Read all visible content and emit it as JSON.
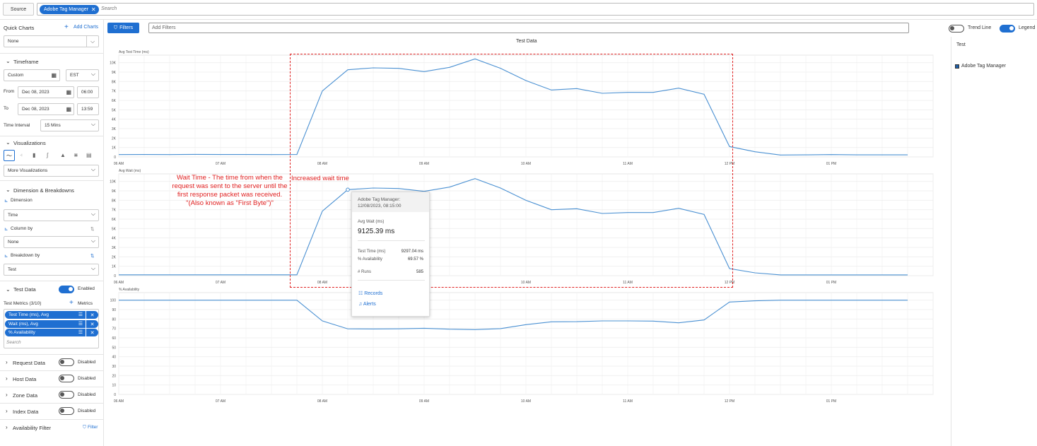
{
  "topbar": {
    "source_label": "Source",
    "chip_label": "Adobe Tag Manager",
    "search_placeholder": "Search"
  },
  "sidebar": {
    "quick_charts": {
      "title": "Quick Charts",
      "add_label": "Add Charts",
      "value": "None"
    },
    "timeframe": {
      "title": "Timeframe",
      "range_value": "Custom",
      "tz_value": "EST",
      "from_label": "From",
      "from_date": "Dec 08, 2023",
      "from_time": "06:00",
      "to_label": "To",
      "to_date": "Dec 08, 2023",
      "to_time": "13:59",
      "interval_label": "Time Interval",
      "interval_value": "15 Mins"
    },
    "visualizations": {
      "title": "Visualizations",
      "more": "More Visualizations"
    },
    "dimension": {
      "title": "Dimension & Breakdowns",
      "dimension_label": "Dimension",
      "dimension_value": "Time",
      "column_label": "Column by",
      "column_value": "None",
      "breakdown_label": "Breakdown by",
      "breakdown_value": "Test"
    },
    "test_data": {
      "title": "Test Data",
      "status": "Enabled",
      "metrics_label": "Test Metrics (3/10)",
      "metrics_add": "Metrics",
      "metrics": [
        "Test Time (ms), Avg",
        "Wait (ms), Avg",
        "% Availability"
      ],
      "search_placeholder": "Search"
    },
    "sections": [
      {
        "title": "Request Data",
        "status": "Disabled"
      },
      {
        "title": "Host Data",
        "status": "Disabled"
      },
      {
        "title": "Zone Data",
        "status": "Disabled"
      },
      {
        "title": "Index Data",
        "status": "Disabled"
      }
    ],
    "availability": {
      "title": "Availability Filter",
      "filter_label": "Filter"
    }
  },
  "filters": {
    "button": "Filters",
    "placeholder": "Add Filters"
  },
  "toggles": {
    "trend_line": "Trend Line",
    "legend": "Legend"
  },
  "main": {
    "title": "Test Data"
  },
  "legend_panel": {
    "title": "Test",
    "item": "Adobe Tag Manager",
    "item_color": "#1f5fa8"
  },
  "tooltip": {
    "head_line1": "Adobe Tag Manager:",
    "head_line2": "12/08/2023, 08:15:00",
    "metric_label": "Avg Wait (ms)",
    "metric_value": "9125.39 ms",
    "rows": [
      {
        "label": "Test Time (ms)",
        "value": "9297.04 ms"
      },
      {
        "label": "% Availability",
        "value": "69.57 %"
      },
      {
        "label": "# Runs",
        "value": "585"
      }
    ],
    "records": "Records",
    "alerts": "Alerts"
  },
  "annotations": {
    "wait_time": [
      "Wait Time - The time from when the",
      "request was sent to the server until the",
      "first response packet was received.",
      "\"(Also known as \"First Byte\")\""
    ],
    "increased": "Increased wait time",
    "color": "#e02020"
  },
  "chart_data": [
    {
      "type": "line",
      "title": "",
      "ylabel": "Avg Test Time (ms)",
      "xlabel": "",
      "x_ticks": [
        "06 AM",
        "07 AM",
        "08 AM",
        "09 AM",
        "10 AM",
        "11 AM",
        "12 PM",
        "01 PM"
      ],
      "y_ticks": [
        "0",
        "1K",
        "2K",
        "3K",
        "4K",
        "5K",
        "6K",
        "7K",
        "8K",
        "9K",
        "10K"
      ],
      "ylim": [
        0,
        10500
      ],
      "x": [
        6,
        6.25,
        6.5,
        6.75,
        7,
        7.25,
        7.5,
        7.75,
        8,
        8.25,
        8.5,
        8.75,
        9,
        9.25,
        9.5,
        9.75,
        10,
        10.25,
        10.5,
        10.75,
        11,
        11.25,
        11.5,
        11.75,
        12,
        12.25,
        12.5,
        12.75,
        13,
        13.25,
        13.5,
        13.75
      ],
      "values": [
        250,
        260,
        250,
        270,
        255,
        260,
        250,
        260,
        7000,
        9250,
        9450,
        9400,
        9050,
        9500,
        10400,
        9400,
        8100,
        7100,
        7250,
        6750,
        6850,
        6850,
        7300,
        6650,
        1100,
        550,
        200,
        220,
        250,
        220,
        220,
        220
      ]
    },
    {
      "type": "line",
      "title": "",
      "ylabel": "Avg Wait (ms)",
      "xlabel": "",
      "x_ticks": [
        "06 AM",
        "07 AM",
        "08 AM",
        "09 AM",
        "10 AM",
        "11 AM",
        "12 PM",
        "01 PM"
      ],
      "y_ticks": [
        "0",
        "1K",
        "2K",
        "3K",
        "4K",
        "5K",
        "6K",
        "7K",
        "8K",
        "9K",
        "10K"
      ],
      "ylim": [
        0,
        10500
      ],
      "x": [
        6,
        6.25,
        6.5,
        6.75,
        7,
        7.25,
        7.5,
        7.75,
        8,
        8.25,
        8.5,
        8.75,
        9,
        9.25,
        9.5,
        9.75,
        10,
        10.25,
        10.5,
        10.75,
        11,
        11.25,
        11.5,
        11.75,
        12,
        12.25,
        12.5,
        12.75,
        13,
        13.25,
        13.5,
        13.75
      ],
      "values": [
        90,
        90,
        90,
        90,
        90,
        90,
        90,
        90,
        6850,
        9125,
        9300,
        9250,
        8950,
        9400,
        10300,
        9300,
        8000,
        7000,
        7100,
        6600,
        6700,
        6700,
        7150,
        6500,
        750,
        300,
        80,
        80,
        80,
        80,
        80,
        80
      ]
    },
    {
      "type": "line",
      "title": "",
      "ylabel": "% Availability",
      "xlabel": "",
      "x_ticks": [
        "06 AM",
        "07 AM",
        "08 AM",
        "09 AM",
        "10 AM",
        "11 AM",
        "12 PM",
        "01 PM"
      ],
      "y_ticks": [
        "0",
        "10",
        "20",
        "30",
        "40",
        "50",
        "60",
        "70",
        "80",
        "90",
        "100"
      ],
      "ylim": [
        0,
        105
      ],
      "x": [
        6,
        6.25,
        6.5,
        6.75,
        7,
        7.25,
        7.5,
        7.75,
        8,
        8.25,
        8.5,
        8.75,
        9,
        9.25,
        9.5,
        9.75,
        10,
        10.25,
        10.5,
        10.75,
        11,
        11.25,
        11.5,
        11.75,
        12,
        12.25,
        12.5,
        12.75,
        13,
        13.25,
        13.5,
        13.75
      ],
      "values": [
        100,
        100,
        100,
        100,
        100,
        100,
        100,
        100,
        78,
        69.57,
        69.4,
        69.6,
        70.2,
        69.2,
        68.8,
        69.8,
        74,
        77,
        77.2,
        78,
        78,
        77.8,
        76,
        79,
        98,
        99.3,
        100,
        100,
        100,
        100,
        100,
        100
      ]
    }
  ]
}
